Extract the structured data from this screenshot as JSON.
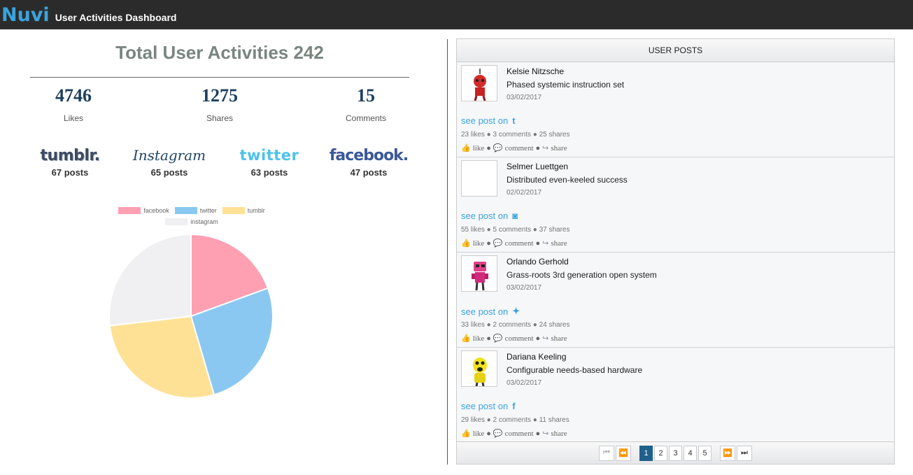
{
  "app": {
    "brand": "Nuvi",
    "title": "User Activities Dashboard"
  },
  "summary": {
    "title": "Total User Activities 242",
    "stats": [
      {
        "value": "4746",
        "label": "Likes"
      },
      {
        "value": "1275",
        "label": "Shares"
      },
      {
        "value": "15",
        "label": "Comments"
      }
    ],
    "networks": [
      {
        "logo": "tumblr.",
        "posts": "67 posts"
      },
      {
        "logo": "Instagram",
        "posts": "65 posts"
      },
      {
        "logo": "twitter",
        "posts": "63 posts"
      },
      {
        "logo": "facebook.",
        "posts": "47 posts"
      }
    ]
  },
  "chart_data": {
    "type": "pie",
    "categories": [
      "facebook",
      "twitter",
      "tumblr",
      "instagram"
    ],
    "values": [
      47,
      63,
      67,
      65
    ],
    "colors": [
      "#ff9fb2",
      "#8ac8f2",
      "#ffe196",
      "#f0f0f2"
    ],
    "legend_position": "top"
  },
  "posts_panel": {
    "header": "USER POSTS",
    "posts": [
      {
        "name": "Kelsie Nitzsche",
        "text": "Phased systemic instruction set",
        "date": "03/02/2017",
        "see": "see post on",
        "network_icon": "tumblr-icon",
        "network_glyph": "t",
        "stats": "23 likes ● 3 comments ● 25 shares",
        "avatar": "red-robot"
      },
      {
        "name": "Selmer Luettgen",
        "text": "Distributed even-keeled success",
        "date": "02/02/2017",
        "see": "see post on",
        "network_icon": "instagram-icon",
        "network_glyph": "◙",
        "stats": "55 likes ● 5 comments ● 37 shares",
        "avatar": "blank"
      },
      {
        "name": "Orlando Gerhold",
        "text": "Grass-roots 3rd generation open system",
        "date": "03/02/2017",
        "see": "see post on",
        "network_icon": "twitter-icon",
        "network_glyph": "✦",
        "stats": "33 likes ● 2 comments ● 24 shares",
        "avatar": "pink-robot"
      },
      {
        "name": "Dariana Keeling",
        "text": "Configurable needs-based hardware",
        "date": "03/02/2017",
        "see": "see post on",
        "network_icon": "facebook-icon",
        "network_glyph": "f",
        "stats": "29 likes ● 2 comments ● 11 shares",
        "avatar": "yellow-robot"
      }
    ],
    "actions": {
      "like": "like",
      "comment": "comment",
      "share": "share",
      "sep": "●"
    },
    "pager": {
      "pages": [
        "1",
        "2",
        "3",
        "4",
        "5"
      ],
      "current": "1",
      "first": "⏮",
      "prev": "⏪",
      "next": "⏩",
      "last": "⏭"
    }
  }
}
